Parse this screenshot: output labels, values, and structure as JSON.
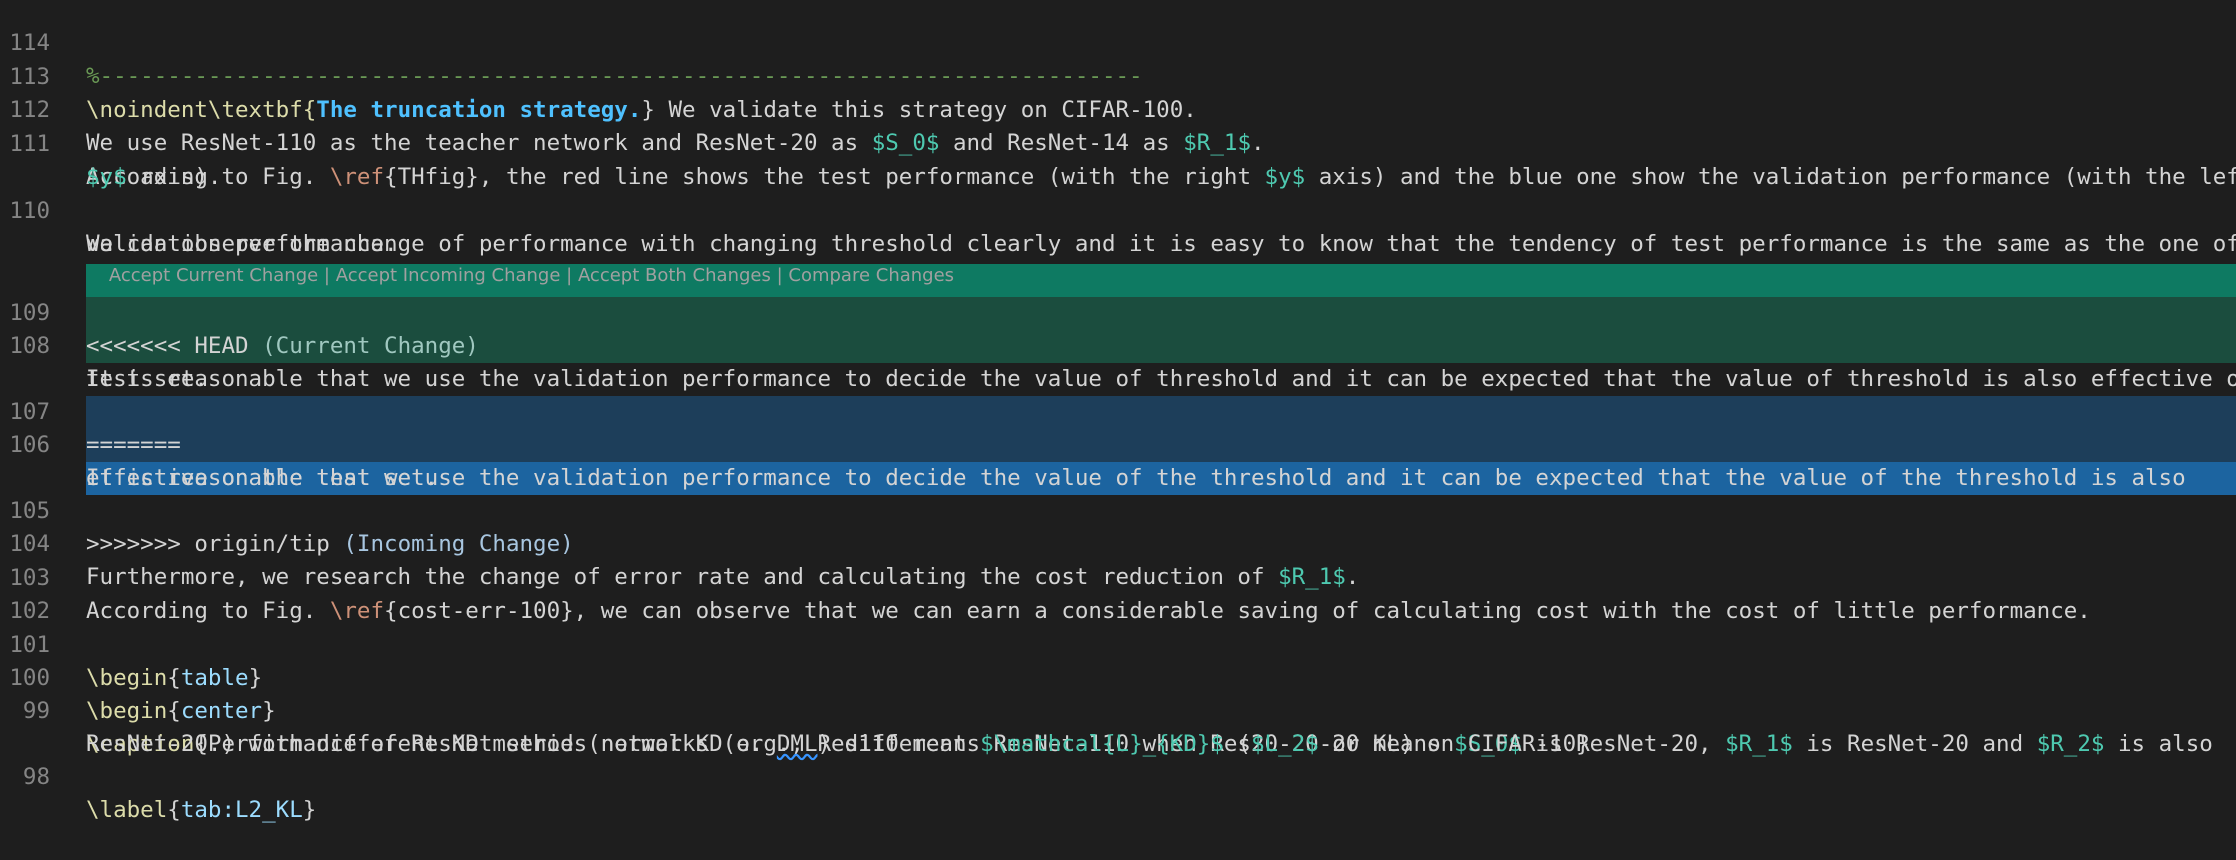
{
  "editor": {
    "line_numbers": [
      "114",
      "113",
      "112",
      "111",
      "110",
      "109",
      "108",
      "107",
      "106",
      "105",
      "104",
      "103",
      "102",
      "101",
      "100",
      "99",
      "98"
    ],
    "l114": "%-----------------------------------------------------------------------------",
    "l113": {
      "a": "\\noindent\\textbf{",
      "b": "The truncation strategy.",
      "c": "} We validate this strategy on CIFAR-100."
    },
    "l112": {
      "a": "We use ResNet-110 as the teacher network and ResNet-20 as ",
      "b": "$S_0$",
      "c": " and ResNet-14 as ",
      "d": "$R_1$",
      "e": "."
    },
    "l111": {
      "a": "According to Fig. ",
      "b": "\\ref",
      "c": "{THfig}, the red line shows the test performance (with the right ",
      "d": "$y$",
      "e": " axis) and the blue one show the validation performance (with the left",
      "f": "$y$",
      "g": " axis)."
    },
    "l110": {
      "a": "We can observe the change of performance with changing threshold clearly and it is easy to know that the tendency of test performance is the same as the one of",
      "b": "validation performance."
    },
    "codelens": {
      "accept_current": "Accept Current Change",
      "accept_incoming": "Accept Incoming Change",
      "accept_both": "Accept Both Changes",
      "compare": "Compare Changes",
      "sep": " | "
    },
    "l109": {
      "a": "<<<<<<< HEAD",
      "b": " (Current Change)"
    },
    "l108": {
      "a": "It is reasonable that we use the validation performance to decide the value of threshold and it can be expected that the value of threshold is also effective on",
      "b": "test set."
    },
    "l107": "=======",
    "l106": {
      "a": "It is reasonable that we use the validation performance to decide the value of the threshold and it can be expected that the value of the threshold is also",
      "b": "effective on the test set."
    },
    "l105": {
      "a": ">>>>>>> origin/tip",
      "b": " (Incoming Change)"
    },
    "l104": {
      "a": "Furthermore, we research the change of error rate and calculating the cost reduction of ",
      "b": "$R_1$",
      "c": "."
    },
    "l103": {
      "a": "According to Fig. ",
      "b": "\\ref",
      "c": "{cost-err-100}, we can observe that we can earn a considerable saving of calculating cost with the cost of little performance."
    },
    "l101": {
      "a": "\\begin",
      "b": "{",
      "c": "table",
      "d": "}"
    },
    "l100": {
      "a": "\\begin",
      "b": "{",
      "c": "center",
      "d": "}"
    },
    "l99": {
      "a": "\\caption",
      "b": "{Performance of ResNet series networks (e.g., Res110 means ResNet-110 when Res20-20-20 means ",
      "c": "$S_0$",
      "d": " is ResNet-20, ",
      "e": "$R_1$",
      "f": " is ResNet-20 and ",
      "g": "$R_2$",
      "h": " is also",
      "i": "ResNet-20.) with different KD method (normal KD or ",
      "j": "DML",
      "k": ") different ",
      "l": "$\\mathcal{L}_{KD}$",
      "m": " (",
      "n": "$L_2$",
      "o": " or KL) on CIFAR-10}"
    },
    "l98": {
      "a": "\\label",
      "b": "{",
      "c": "tab:L2_KL",
      "d": "}"
    }
  }
}
